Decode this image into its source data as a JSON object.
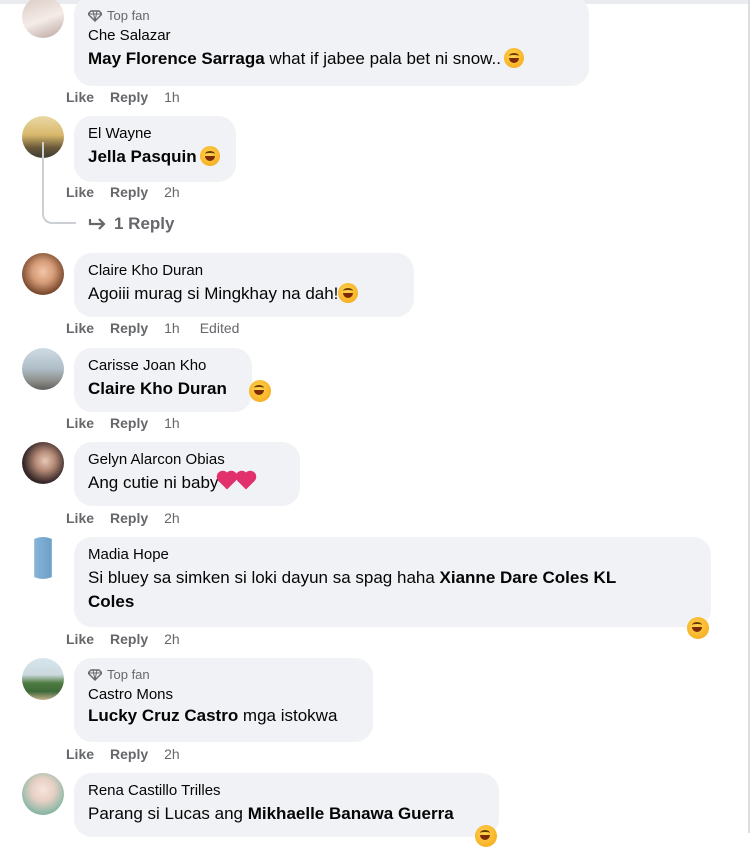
{
  "actions": {
    "like": "Like",
    "reply": "Reply"
  },
  "replies_link": "1 Reply",
  "top_fan_label": "Top fan",
  "comments": [
    {
      "name": "Che Salazar",
      "mention": "May Florence Sarraga",
      "text": " what if jabee pala bet ni snow..",
      "time": "1h",
      "top_fan": true
    },
    {
      "name": "El Wayne",
      "mention": "Jella Pasquin",
      "text": "",
      "time": "2h"
    },
    {
      "name": "Claire Kho Duran",
      "mention": "",
      "text": "Agoiii murag si Mingkhay na dah!",
      "time": "1h",
      "edited": "Edited"
    },
    {
      "name": "Carisse Joan Kho",
      "mention": "Claire Kho Duran",
      "text": "",
      "time": "1h"
    },
    {
      "name": "Gelyn Alarcon Obias",
      "mention": "",
      "text": "Ang cutie ni baby",
      "time": "2h"
    },
    {
      "name": "Madia Hope",
      "text_line1": "Si bluey sa simken si loki dayun sa spag haha ",
      "mention_line1": "Xianne Dare Coles KL",
      "mention_line2": "Coles",
      "time": "2h"
    },
    {
      "name": "Castro Mons",
      "mention": "Lucky Cruz Castro",
      "text": " mga istokwa",
      "time": "2h",
      "top_fan": true
    },
    {
      "name": "Rena Castillo Trilles",
      "text": "Parang si Lucas ang ",
      "mention": "Mikhaelle Banawa Guerra"
    }
  ],
  "colors": {
    "bubble": "#f0f2f5",
    "secondary_text": "#65676b",
    "primary_text": "#050505"
  }
}
